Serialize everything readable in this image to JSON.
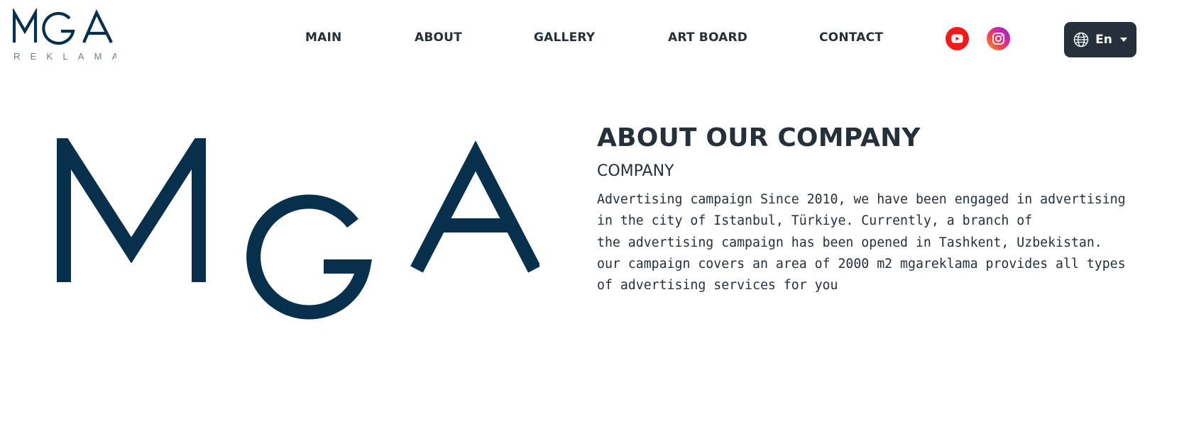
{
  "brand": {
    "logo_wordmark": "MGA",
    "logo_tagline": "REKLAMA"
  },
  "nav": {
    "items": [
      {
        "label": "MAIN"
      },
      {
        "label": "ABOUT"
      },
      {
        "label": "GALLERY"
      },
      {
        "label": "ART BOARD"
      },
      {
        "label": "CONTACT"
      }
    ]
  },
  "social": {
    "youtube_icon": "youtube-icon",
    "instagram_icon": "instagram-icon"
  },
  "language": {
    "current": "En",
    "icon": "globe-icon"
  },
  "hero": {
    "wordmark": "MGA"
  },
  "about": {
    "title": "ABOUT OUR COMPANY",
    "subtitle": "COMPANY",
    "paragraph_lines": [
      "Advertising campaign Since 2010, we have been engaged in advertising",
      "in the city of Istanbul, Türkiye. Currently, a branch of",
      "the advertising campaign has been opened in Tashkent, Uzbekistan.",
      "our campaign covers an area of 2000 m2 mgareklama provides all types",
      "of advertising services for you"
    ]
  },
  "colors": {
    "brand_navy": "#07304d",
    "text_dark": "#25303a",
    "youtube_red": "#ef1a1a",
    "lang_button_bg": "#25303a",
    "background": "#ffffff"
  }
}
